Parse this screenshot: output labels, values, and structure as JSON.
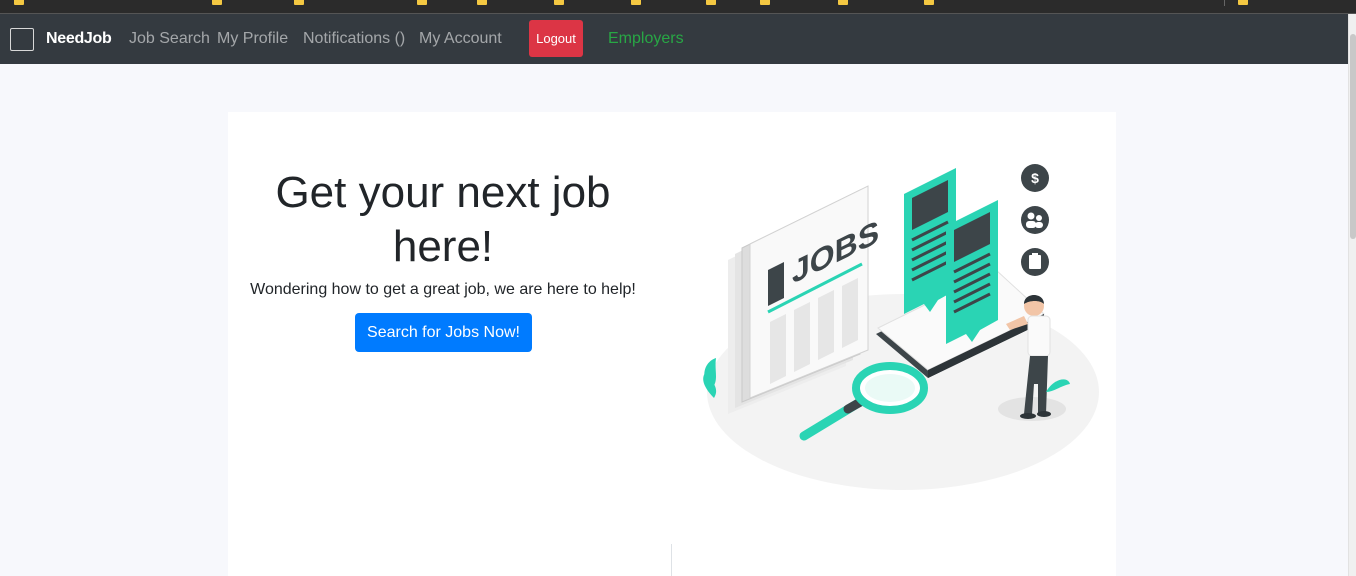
{
  "navbar": {
    "brand": "NeedJob",
    "links": [
      "Job Search",
      "My Profile",
      "Notifications ()",
      "My Account"
    ],
    "logout_label": "Logout",
    "employers_label": "Employers"
  },
  "hero": {
    "title": "Get your next job here!",
    "subtitle": "Wondering how to get a great job, we are here to help!",
    "cta_label": "Search for Jobs Now!",
    "illustration_text": "JOBS"
  },
  "colors": {
    "navbar_bg": "#343a40",
    "logout_bg": "#dc3545",
    "employers_text": "#28a745",
    "cta_bg": "#007bff",
    "illustration_accent": "#2ad4b4"
  }
}
